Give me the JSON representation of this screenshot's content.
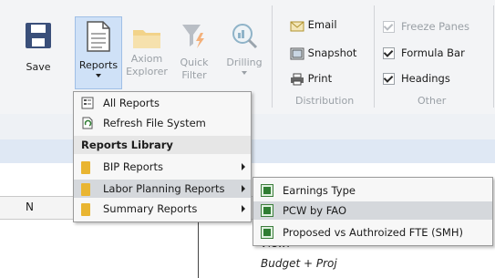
{
  "ribbon": {
    "save_label": "Save",
    "reports_label": "Reports",
    "axiom_label_1": "Axiom",
    "axiom_label_2": "Explorer",
    "quick_label_1": "Quick",
    "quick_label_2": "Filter",
    "drilling_label": "Drilling",
    "email_label": "Email",
    "snapshot_label": "Snapshot",
    "print_label": "Print",
    "distribution_label": "Distribution",
    "freeze_label": "Freeze Panes",
    "formula_label": "Formula Bar",
    "headings_label": "Headings",
    "other_label": "Other"
  },
  "sheet": {
    "column_letter": "N",
    "view_text": "View:",
    "budget_text": "Budget + Proj"
  },
  "menu": {
    "all_reports": "All Reports",
    "refresh": "Refresh File System",
    "library_header": "Reports Library",
    "items": [
      {
        "label": "BIP Reports"
      },
      {
        "label": "Labor Planning Reports"
      },
      {
        "label": "Summary Reports"
      }
    ]
  },
  "submenu": {
    "items": [
      {
        "label": "Earnings Type"
      },
      {
        "label": "PCW by FAO"
      },
      {
        "label": "Proposed vs Authroized FTE (SMH)"
      }
    ]
  },
  "colors": {
    "accent": "#4a6fa5",
    "save_icon": "#3a4f7a",
    "folder": "#e9b531",
    "excel_green": "#2f7d32"
  }
}
